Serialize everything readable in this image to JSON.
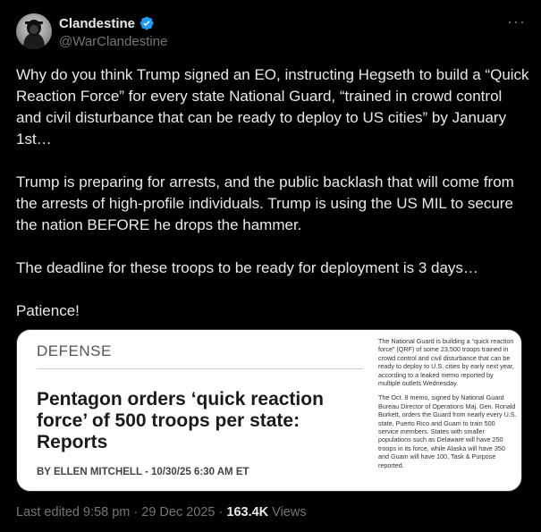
{
  "author": {
    "display_name": "Clandestine",
    "handle": "@WarClandestine",
    "avatar_icon": "hooded-figure-avatar",
    "verified_icon": "verified-badge-icon",
    "verified_color": "#1d9bf0"
  },
  "more_icon": "more-options-icon",
  "tweet": {
    "paragraphs": [
      "Why do you think Trump signed an EO, instructing Hegseth to build a “Quick Reaction Force” for every state National Guard, “trained in crowd control and civil disturbance that can be ready to deploy to US cities” by January 1st…",
      "Trump is preparing for arrests, and the public backlash that will come from the arrests of high-profile individuals. Trump is using the US MIL to secure the nation BEFORE he drops the hammer.",
      "The deadline for these troops to be ready for deployment is 3 days…",
      "Patience!"
    ]
  },
  "media": {
    "section": "DEFENSE",
    "headline": "Pentagon orders ‘quick reaction force’ of 500 troops per state: Reports",
    "byline": "BY ELLEN MITCHELL - 10/30/25 6:30 AM ET",
    "side_paragraphs": [
      "The National Guard is building a “quick reaction force” (QRF) of some 23,500 troops trained in crowd control and civil disturbance that can be ready to deploy to U.S. cities by early next year, according to a leaked memo reported by multiple outlets Wednesday.",
      "The Oct. 8 memo, signed by National Guard Bureau Director of Operations Maj. Gen. Ronald Burkett, orders the Guard from nearly every U.S. state, Puerto Rico and Guam to train 500 service members. States with smaller populations such as Delaware will have 250 troops in its force, while Alaska will have 350 and Guam will have 100, Task & Purpose reported."
    ]
  },
  "footer": {
    "edited": "Last edited 9:58 pm · 29 Dec 2025 · ",
    "views_count": "163.4K",
    "views_label": " Views"
  }
}
